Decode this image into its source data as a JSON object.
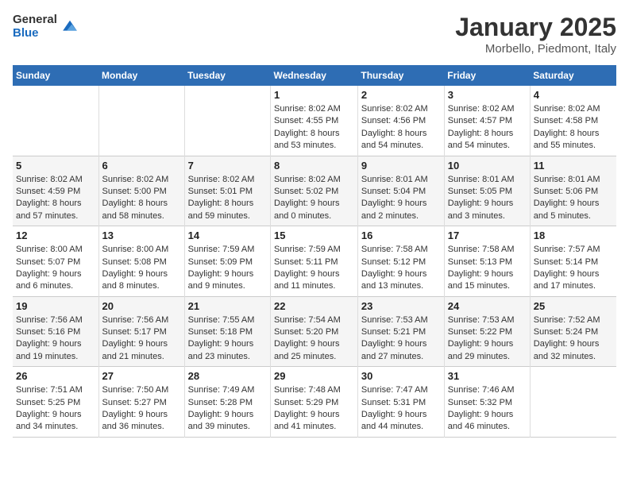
{
  "header": {
    "logo_general": "General",
    "logo_blue": "Blue",
    "month_title": "January 2025",
    "location": "Morbello, Piedmont, Italy"
  },
  "days_header": [
    "Sunday",
    "Monday",
    "Tuesday",
    "Wednesday",
    "Thursday",
    "Friday",
    "Saturday"
  ],
  "weeks": [
    [
      {
        "num": "",
        "info": ""
      },
      {
        "num": "",
        "info": ""
      },
      {
        "num": "",
        "info": ""
      },
      {
        "num": "1",
        "info": "Sunrise: 8:02 AM\nSunset: 4:55 PM\nDaylight: 8 hours and 53 minutes."
      },
      {
        "num": "2",
        "info": "Sunrise: 8:02 AM\nSunset: 4:56 PM\nDaylight: 8 hours and 54 minutes."
      },
      {
        "num": "3",
        "info": "Sunrise: 8:02 AM\nSunset: 4:57 PM\nDaylight: 8 hours and 54 minutes."
      },
      {
        "num": "4",
        "info": "Sunrise: 8:02 AM\nSunset: 4:58 PM\nDaylight: 8 hours and 55 minutes."
      }
    ],
    [
      {
        "num": "5",
        "info": "Sunrise: 8:02 AM\nSunset: 4:59 PM\nDaylight: 8 hours and 57 minutes."
      },
      {
        "num": "6",
        "info": "Sunrise: 8:02 AM\nSunset: 5:00 PM\nDaylight: 8 hours and 58 minutes."
      },
      {
        "num": "7",
        "info": "Sunrise: 8:02 AM\nSunset: 5:01 PM\nDaylight: 8 hours and 59 minutes."
      },
      {
        "num": "8",
        "info": "Sunrise: 8:02 AM\nSunset: 5:02 PM\nDaylight: 9 hours and 0 minutes."
      },
      {
        "num": "9",
        "info": "Sunrise: 8:01 AM\nSunset: 5:04 PM\nDaylight: 9 hours and 2 minutes."
      },
      {
        "num": "10",
        "info": "Sunrise: 8:01 AM\nSunset: 5:05 PM\nDaylight: 9 hours and 3 minutes."
      },
      {
        "num": "11",
        "info": "Sunrise: 8:01 AM\nSunset: 5:06 PM\nDaylight: 9 hours and 5 minutes."
      }
    ],
    [
      {
        "num": "12",
        "info": "Sunrise: 8:00 AM\nSunset: 5:07 PM\nDaylight: 9 hours and 6 minutes."
      },
      {
        "num": "13",
        "info": "Sunrise: 8:00 AM\nSunset: 5:08 PM\nDaylight: 9 hours and 8 minutes."
      },
      {
        "num": "14",
        "info": "Sunrise: 7:59 AM\nSunset: 5:09 PM\nDaylight: 9 hours and 9 minutes."
      },
      {
        "num": "15",
        "info": "Sunrise: 7:59 AM\nSunset: 5:11 PM\nDaylight: 9 hours and 11 minutes."
      },
      {
        "num": "16",
        "info": "Sunrise: 7:58 AM\nSunset: 5:12 PM\nDaylight: 9 hours and 13 minutes."
      },
      {
        "num": "17",
        "info": "Sunrise: 7:58 AM\nSunset: 5:13 PM\nDaylight: 9 hours and 15 minutes."
      },
      {
        "num": "18",
        "info": "Sunrise: 7:57 AM\nSunset: 5:14 PM\nDaylight: 9 hours and 17 minutes."
      }
    ],
    [
      {
        "num": "19",
        "info": "Sunrise: 7:56 AM\nSunset: 5:16 PM\nDaylight: 9 hours and 19 minutes."
      },
      {
        "num": "20",
        "info": "Sunrise: 7:56 AM\nSunset: 5:17 PM\nDaylight: 9 hours and 21 minutes."
      },
      {
        "num": "21",
        "info": "Sunrise: 7:55 AM\nSunset: 5:18 PM\nDaylight: 9 hours and 23 minutes."
      },
      {
        "num": "22",
        "info": "Sunrise: 7:54 AM\nSunset: 5:20 PM\nDaylight: 9 hours and 25 minutes."
      },
      {
        "num": "23",
        "info": "Sunrise: 7:53 AM\nSunset: 5:21 PM\nDaylight: 9 hours and 27 minutes."
      },
      {
        "num": "24",
        "info": "Sunrise: 7:53 AM\nSunset: 5:22 PM\nDaylight: 9 hours and 29 minutes."
      },
      {
        "num": "25",
        "info": "Sunrise: 7:52 AM\nSunset: 5:24 PM\nDaylight: 9 hours and 32 minutes."
      }
    ],
    [
      {
        "num": "26",
        "info": "Sunrise: 7:51 AM\nSunset: 5:25 PM\nDaylight: 9 hours and 34 minutes."
      },
      {
        "num": "27",
        "info": "Sunrise: 7:50 AM\nSunset: 5:27 PM\nDaylight: 9 hours and 36 minutes."
      },
      {
        "num": "28",
        "info": "Sunrise: 7:49 AM\nSunset: 5:28 PM\nDaylight: 9 hours and 39 minutes."
      },
      {
        "num": "29",
        "info": "Sunrise: 7:48 AM\nSunset: 5:29 PM\nDaylight: 9 hours and 41 minutes."
      },
      {
        "num": "30",
        "info": "Sunrise: 7:47 AM\nSunset: 5:31 PM\nDaylight: 9 hours and 44 minutes."
      },
      {
        "num": "31",
        "info": "Sunrise: 7:46 AM\nSunset: 5:32 PM\nDaylight: 9 hours and 46 minutes."
      },
      {
        "num": "",
        "info": ""
      }
    ]
  ]
}
